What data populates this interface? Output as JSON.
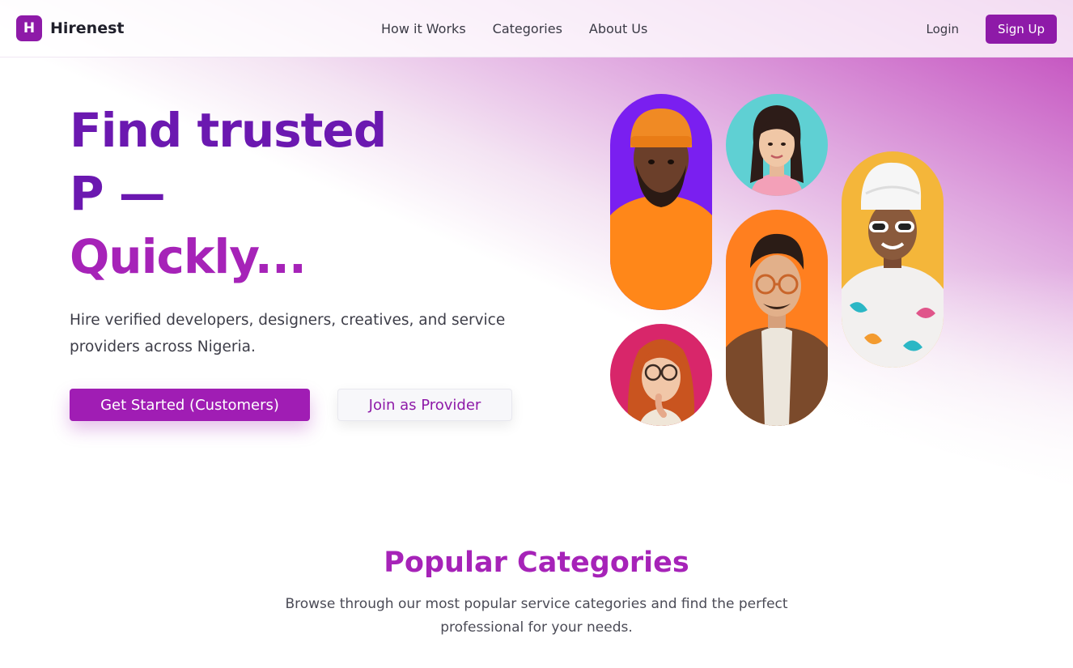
{
  "brand": {
    "logo_letter": "H",
    "name": "Hirenest"
  },
  "nav": {
    "links": [
      "How it Works",
      "Categories",
      "About Us"
    ],
    "login_label": "Login",
    "signup_label": "Sign Up"
  },
  "hero": {
    "title_lines": [
      "Find trusted",
      "P —",
      "Quickly..."
    ],
    "subtitle": "Hire verified developers, designers, creatives, and service providers across Nigeria.",
    "primary_cta": "Get Started (Customers)",
    "secondary_cta": "Join as Provider",
    "portraits": [
      {
        "name": "portrait-man-orange-beanie",
        "bg": "#7a1ff0"
      },
      {
        "name": "portrait-woman-smiling",
        "bg": "#5fd0d3"
      },
      {
        "name": "portrait-woman-sunglasses",
        "bg": "#f4b63a"
      },
      {
        "name": "portrait-man-glasses",
        "bg": "#ff7f1f"
      },
      {
        "name": "portrait-woman-redhead",
        "bg": "#d8266a"
      }
    ]
  },
  "colors": {
    "brand_primary": "#8e1aa8",
    "title_dark": "#6b18b0",
    "title_accent": "#a623b8"
  },
  "popular_categories": {
    "title": "Popular Categories",
    "description": "Browse through our most popular service categories and find the perfect professional for your needs."
  }
}
